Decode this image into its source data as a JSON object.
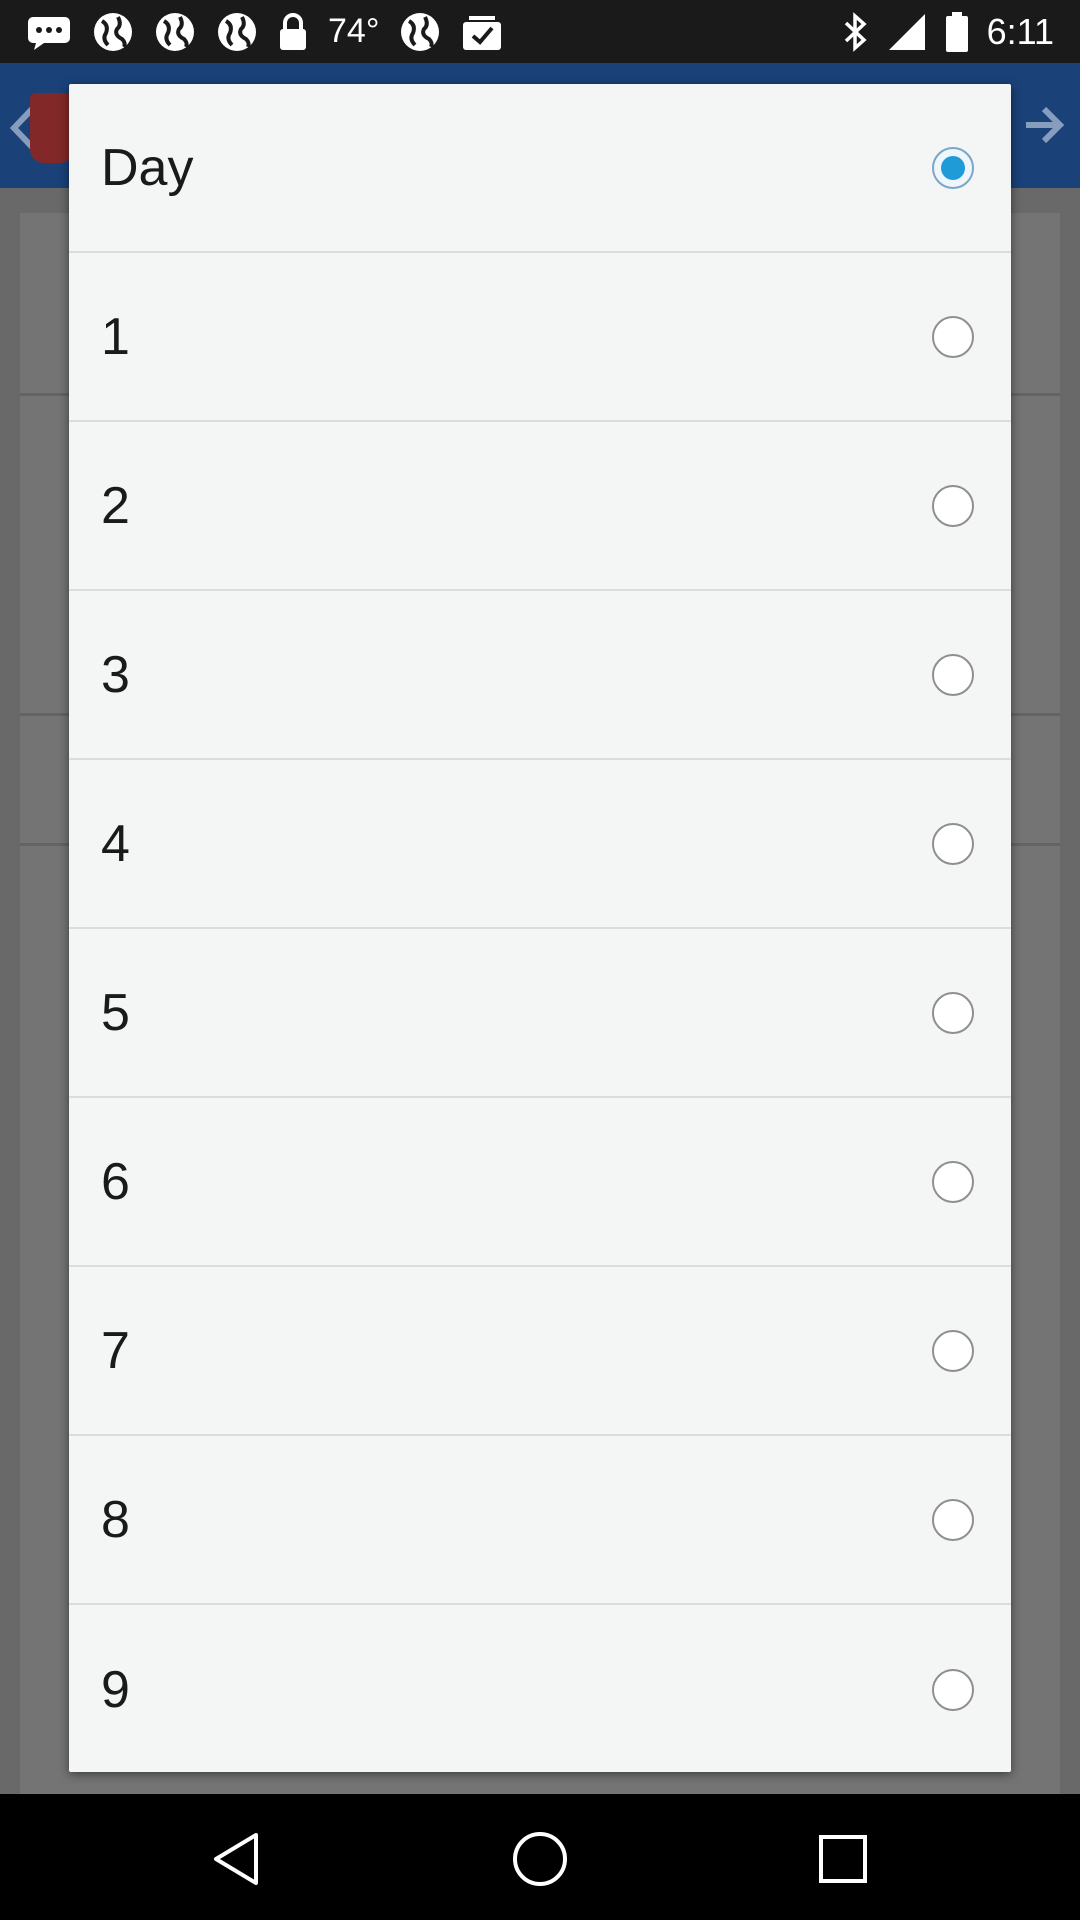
{
  "status_bar": {
    "temperature": "74°",
    "time": "6:11",
    "left_icons": [
      "chat-icon",
      "globe-icon",
      "globe-icon",
      "globe-icon",
      "lock-icon"
    ],
    "right_icons": [
      "bluetooth-icon",
      "signal-icon",
      "battery-icon"
    ]
  },
  "dialog": {
    "options": [
      {
        "label": "Day",
        "checked": true
      },
      {
        "label": "1",
        "checked": false
      },
      {
        "label": "2",
        "checked": false
      },
      {
        "label": "3",
        "checked": false
      },
      {
        "label": "4",
        "checked": false
      },
      {
        "label": "5",
        "checked": false
      },
      {
        "label": "6",
        "checked": false
      },
      {
        "label": "7",
        "checked": false
      },
      {
        "label": "8",
        "checked": false
      },
      {
        "label": "9",
        "checked": false
      }
    ]
  },
  "colors": {
    "accent": "#1f9bd7",
    "dialog_bg": "#f4f5f5",
    "app_header": "#1c4680"
  },
  "nav_bar": {
    "buttons": [
      "back-icon",
      "home-icon",
      "recents-icon"
    ]
  }
}
